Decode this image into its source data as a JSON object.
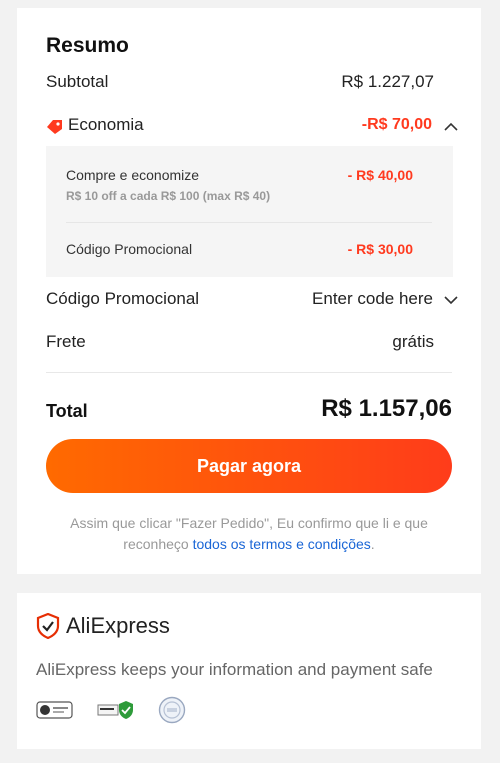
{
  "summary": {
    "title": "Resumo",
    "subtotal_label": "Subtotal",
    "subtotal_value": "R$ 1.227,07",
    "savings_label": "Economia",
    "savings_value": "-R$ 70,00",
    "savings_items": [
      {
        "label": "Compre e economize",
        "sublabel": "R$ 10 off a cada R$ 100 (max R$ 40)",
        "value": "- R$ 40,00"
      },
      {
        "label": "Código Promocional",
        "value": "- R$ 30,00"
      }
    ],
    "promo_label": "Código Promocional",
    "promo_placeholder": "Enter code here",
    "shipping_label": "Frete",
    "shipping_value": "grátis",
    "total_label": "Total",
    "total_value": "R$ 1.157,06",
    "pay_button": "Pagar agora",
    "terms_text": "Assim que clicar \"Fazer Pedido\", Eu confirmo que li e que reconheço ",
    "terms_link": "todos os termos e condições",
    "terms_end": "."
  },
  "security": {
    "brand": "AliExpress",
    "message": "AliExpress keeps your information and payment safe"
  },
  "colors": {
    "accent": "#ff3a1f",
    "button_start": "#ff6a00",
    "button_end": "#ff3c1a",
    "link": "#1a66d6"
  }
}
